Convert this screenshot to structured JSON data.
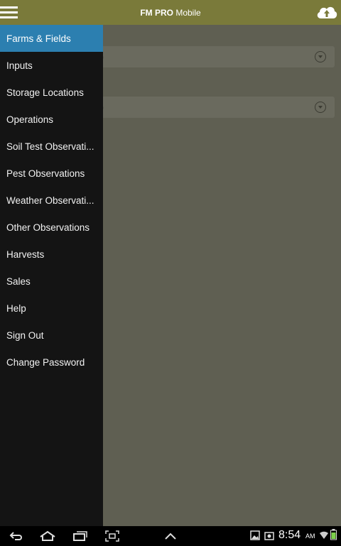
{
  "appbar": {
    "title_bold": "FM PRO",
    "title_rest": " Mobile",
    "menu_icon": "hamburger-icon",
    "sync_icon": "cloud-upload-icon"
  },
  "content": {
    "dropdowns": [
      {
        "text": ")"
      },
      {
        "text": ")"
      }
    ]
  },
  "drawer": {
    "items": [
      {
        "label": "Farms & Fields",
        "active": true
      },
      {
        "label": "Inputs"
      },
      {
        "label": "Storage Locations"
      },
      {
        "label": "Operations"
      },
      {
        "label": "Soil Test Observati..."
      },
      {
        "label": "Pest Observations"
      },
      {
        "label": "Weather Observati..."
      },
      {
        "label": "Other Observations"
      },
      {
        "label": "Harvests"
      },
      {
        "label": "Sales"
      },
      {
        "label": "Help"
      },
      {
        "label": "Sign Out"
      },
      {
        "label": "Change Password"
      }
    ]
  },
  "statusbar": {
    "time": "8:54",
    "ampm": "AM"
  },
  "colors": {
    "appbar": "#7a7a3a",
    "drawer": "#141414",
    "active": "#2c7fb0",
    "overlay": "#5f5f52"
  }
}
